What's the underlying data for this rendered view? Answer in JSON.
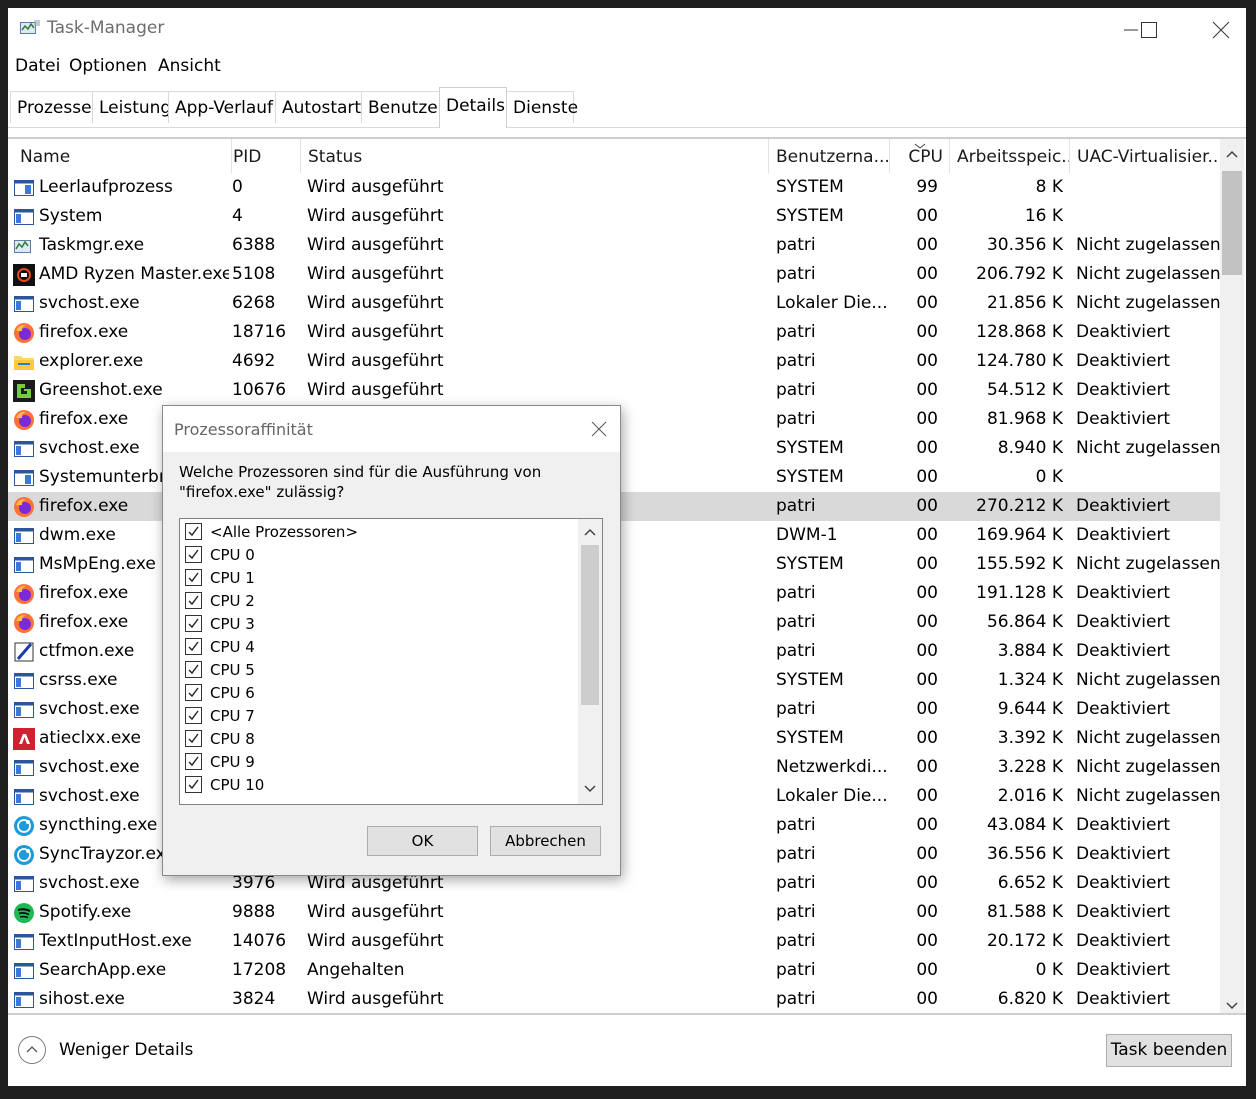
{
  "window": {
    "title": "Task-Manager"
  },
  "menu": [
    "Datei",
    "Optionen",
    "Ansicht"
  ],
  "tabs": [
    "Prozesse",
    "Leistung",
    "App-Verlauf",
    "Autostart",
    "Benutzer",
    "Details",
    "Dienste"
  ],
  "active_tab": "Details",
  "columns": {
    "name": "Name",
    "pid": "PID",
    "status": "Status",
    "user": "Benutzerna...",
    "cpu": "CPU",
    "memory": "Arbeitsspeic...",
    "uac": "UAC-Virtualisier..."
  },
  "processes": [
    {
      "icon": "system-window-icon",
      "name": "Leerlaufprozess",
      "pid": "0",
      "status": "Wird ausgeführt",
      "user": "SYSTEM",
      "cpu": "99",
      "mem": "8 K",
      "uac": ""
    },
    {
      "icon": "window-icon",
      "name": "System",
      "pid": "4",
      "status": "Wird ausgeführt",
      "user": "SYSTEM",
      "cpu": "00",
      "mem": "16 K",
      "uac": ""
    },
    {
      "icon": "taskmgr-icon",
      "name": "Taskmgr.exe",
      "pid": "6388",
      "status": "Wird ausgeführt",
      "user": "patri",
      "cpu": "00",
      "mem": "30.356 K",
      "uac": "Nicht zugelassen"
    },
    {
      "icon": "amd-ryzen-icon",
      "name": "AMD Ryzen Master.exe",
      "pid": "5108",
      "status": "Wird ausgeführt",
      "user": "patri",
      "cpu": "00",
      "mem": "206.792 K",
      "uac": "Nicht zugelassen"
    },
    {
      "icon": "window-icon",
      "name": "svchost.exe",
      "pid": "6268",
      "status": "Wird ausgeführt",
      "user": "Lokaler Die...",
      "cpu": "00",
      "mem": "21.856 K",
      "uac": "Nicht zugelassen"
    },
    {
      "icon": "firefox-icon",
      "name": "firefox.exe",
      "pid": "18716",
      "status": "Wird ausgeführt",
      "user": "patri",
      "cpu": "00",
      "mem": "128.868 K",
      "uac": "Deaktiviert"
    },
    {
      "icon": "explorer-icon",
      "name": "explorer.exe",
      "pid": "4692",
      "status": "Wird ausgeführt",
      "user": "patri",
      "cpu": "00",
      "mem": "124.780 K",
      "uac": "Deaktiviert"
    },
    {
      "icon": "greenshot-icon",
      "name": "Greenshot.exe",
      "pid": "10676",
      "status": "Wird ausgeführt",
      "user": "patri",
      "cpu": "00",
      "mem": "54.512 K",
      "uac": "Deaktiviert"
    },
    {
      "icon": "firefox-icon",
      "name": "firefox.exe",
      "pid": "",
      "status": "",
      "user": "patri",
      "cpu": "00",
      "mem": "81.968 K",
      "uac": "Deaktiviert"
    },
    {
      "icon": "window-icon",
      "name": "svchost.exe",
      "pid": "",
      "status": "",
      "user": "SYSTEM",
      "cpu": "00",
      "mem": "8.940 K",
      "uac": "Nicht zugelassen"
    },
    {
      "icon": "system-window-icon",
      "name": "Systemunterbre",
      "pid": "",
      "status": "",
      "user": "SYSTEM",
      "cpu": "00",
      "mem": "0 K",
      "uac": ""
    },
    {
      "icon": "firefox-icon",
      "name": "firefox.exe",
      "pid": "",
      "status": "",
      "user": "patri",
      "cpu": "00",
      "mem": "270.212 K",
      "uac": "Deaktiviert",
      "selected": true
    },
    {
      "icon": "window-icon",
      "name": "dwm.exe",
      "pid": "",
      "status": "",
      "user": "DWM-1",
      "cpu": "00",
      "mem": "169.964 K",
      "uac": "Deaktiviert"
    },
    {
      "icon": "window-icon",
      "name": "MsMpEng.exe",
      "pid": "",
      "status": "",
      "user": "SYSTEM",
      "cpu": "00",
      "mem": "155.592 K",
      "uac": "Nicht zugelassen"
    },
    {
      "icon": "firefox-icon",
      "name": "firefox.exe",
      "pid": "",
      "status": "",
      "user": "patri",
      "cpu": "00",
      "mem": "191.128 K",
      "uac": "Deaktiviert"
    },
    {
      "icon": "firefox-icon",
      "name": "firefox.exe",
      "pid": "",
      "status": "",
      "user": "patri",
      "cpu": "00",
      "mem": "56.864 K",
      "uac": "Deaktiviert"
    },
    {
      "icon": "ctfmon-icon",
      "name": "ctfmon.exe",
      "pid": "",
      "status": "",
      "user": "patri",
      "cpu": "00",
      "mem": "3.884 K",
      "uac": "Deaktiviert"
    },
    {
      "icon": "window-icon",
      "name": "csrss.exe",
      "pid": "",
      "status": "",
      "user": "SYSTEM",
      "cpu": "00",
      "mem": "1.324 K",
      "uac": "Nicht zugelassen"
    },
    {
      "icon": "window-icon",
      "name": "svchost.exe",
      "pid": "",
      "status": "",
      "user": "patri",
      "cpu": "00",
      "mem": "9.644 K",
      "uac": "Deaktiviert"
    },
    {
      "icon": "amd-icon",
      "name": "atieclxx.exe",
      "pid": "",
      "status": "",
      "user": "SYSTEM",
      "cpu": "00",
      "mem": "3.392 K",
      "uac": "Nicht zugelassen"
    },
    {
      "icon": "window-icon",
      "name": "svchost.exe",
      "pid": "",
      "status": "",
      "user": "Netzwerkdi...",
      "cpu": "00",
      "mem": "3.228 K",
      "uac": "Nicht zugelassen"
    },
    {
      "icon": "window-icon",
      "name": "svchost.exe",
      "pid": "",
      "status": "",
      "user": "Lokaler Die...",
      "cpu": "00",
      "mem": "2.016 K",
      "uac": "Nicht zugelassen"
    },
    {
      "icon": "syncthing-icon",
      "name": "syncthing.exe",
      "pid": "",
      "status": "",
      "user": "patri",
      "cpu": "00",
      "mem": "43.084 K",
      "uac": "Deaktiviert"
    },
    {
      "icon": "syncthing-icon",
      "name": "SyncTrayzor.exe",
      "pid": "",
      "status": "",
      "user": "patri",
      "cpu": "00",
      "mem": "36.556 K",
      "uac": "Deaktiviert"
    },
    {
      "icon": "window-icon",
      "name": "svchost.exe",
      "pid": "3976",
      "status": "Wird ausgeführt",
      "user": "patri",
      "cpu": "00",
      "mem": "6.652 K",
      "uac": "Deaktiviert"
    },
    {
      "icon": "spotify-icon",
      "name": "Spotify.exe",
      "pid": "9888",
      "status": "Wird ausgeführt",
      "user": "patri",
      "cpu": "00",
      "mem": "81.588 K",
      "uac": "Deaktiviert"
    },
    {
      "icon": "window-icon",
      "name": "TextInputHost.exe",
      "pid": "14076",
      "status": "Wird ausgeführt",
      "user": "patri",
      "cpu": "00",
      "mem": "20.172 K",
      "uac": "Deaktiviert"
    },
    {
      "icon": "window-icon",
      "name": "SearchApp.exe",
      "pid": "17208",
      "status": "Angehalten",
      "user": "patri",
      "cpu": "00",
      "mem": "0 K",
      "uac": "Deaktiviert"
    },
    {
      "icon": "window-icon",
      "name": "sihost.exe",
      "pid": "3824",
      "status": "Wird ausgeführt",
      "user": "patri",
      "cpu": "00",
      "mem": "6.820 K",
      "uac": "Deaktiviert"
    }
  ],
  "footer": {
    "fewer_details": "Weniger Details",
    "end_task": "Task beenden"
  },
  "dialog": {
    "title": "Prozessoraffinität",
    "question": "Welche Prozessoren sind für die Ausführung von \"firefox.exe\" zulässig?",
    "items": [
      {
        "label": "<Alle Prozessoren>",
        "checked": true
      },
      {
        "label": "CPU 0",
        "checked": true
      },
      {
        "label": "CPU 1",
        "checked": true
      },
      {
        "label": "CPU 2",
        "checked": true
      },
      {
        "label": "CPU 3",
        "checked": true
      },
      {
        "label": "CPU 4",
        "checked": true
      },
      {
        "label": "CPU 5",
        "checked": true
      },
      {
        "label": "CPU 6",
        "checked": true
      },
      {
        "label": "CPU 7",
        "checked": true
      },
      {
        "label": "CPU 8",
        "checked": true
      },
      {
        "label": "CPU 9",
        "checked": true
      },
      {
        "label": "CPU 10",
        "checked": true
      }
    ],
    "ok": "OK",
    "cancel": "Abbrechen"
  },
  "colors": {
    "selection": "#d9d9d9",
    "window_bg": "#ffffff",
    "dialog_bg": "#f0f0f0"
  }
}
